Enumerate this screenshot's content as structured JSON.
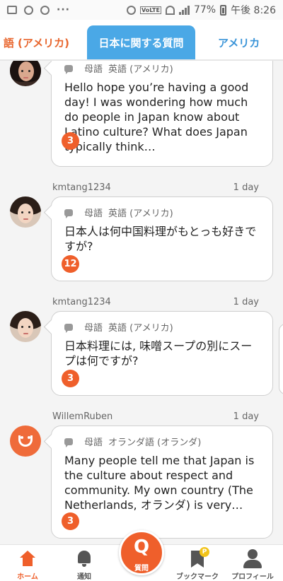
{
  "status_bar": {
    "battery": "77%",
    "time": "午後 8:26",
    "dots": "···",
    "volte": "VoLTE"
  },
  "tabs": [
    {
      "label": "語 (アメリカ)"
    },
    {
      "label": "日本に関する質問",
      "active": true
    },
    {
      "label": "アメリカ"
    }
  ],
  "posts": [
    {
      "user": "",
      "time": "",
      "native_label": "母語",
      "language": "英語 (アメリカ)",
      "text": "Hello hope you’re having a good day! I was wondering how much do people in Japan know about Latino culture? What does Japan typically think…",
      "answers": "3",
      "avatar": "dark-hair-photo"
    },
    {
      "user": "kmtang1234",
      "time": "1 day",
      "native_label": "母語",
      "language": "英語 (アメリカ)",
      "text": "日本人は何中国料理がもとっも好きですが?",
      "answers": "12",
      "avatar": "photo"
    },
    {
      "user": "kmtang1234",
      "time": "1 day",
      "native_label": "母語",
      "language": "英語 (アメリカ)",
      "text": "日本料理には, 味噌スープの別にスープは何ですが?",
      "answers": "3",
      "avatar": "photo"
    },
    {
      "user": "WillemRuben",
      "time": "1 day",
      "native_label": "母語",
      "language": "オランダ語 (オランダ)",
      "text": "Many people tell me that Japan is the culture about respect and community. My own country (The Netherlands, オランダ) is very…",
      "answers": "3",
      "avatar": "default-orange"
    }
  ],
  "bottom_nav": {
    "home": "ホーム",
    "notifications": "通知",
    "ask": "質問",
    "ask_icon": "Q",
    "bookmark": "ブックマーク",
    "bookmark_badge": "P",
    "profile": "プロフィール"
  },
  "colors": {
    "accent_orange": "#ef5f2b",
    "tab_blue": "#4aa8e6",
    "link_blue": "#3a94d8"
  }
}
